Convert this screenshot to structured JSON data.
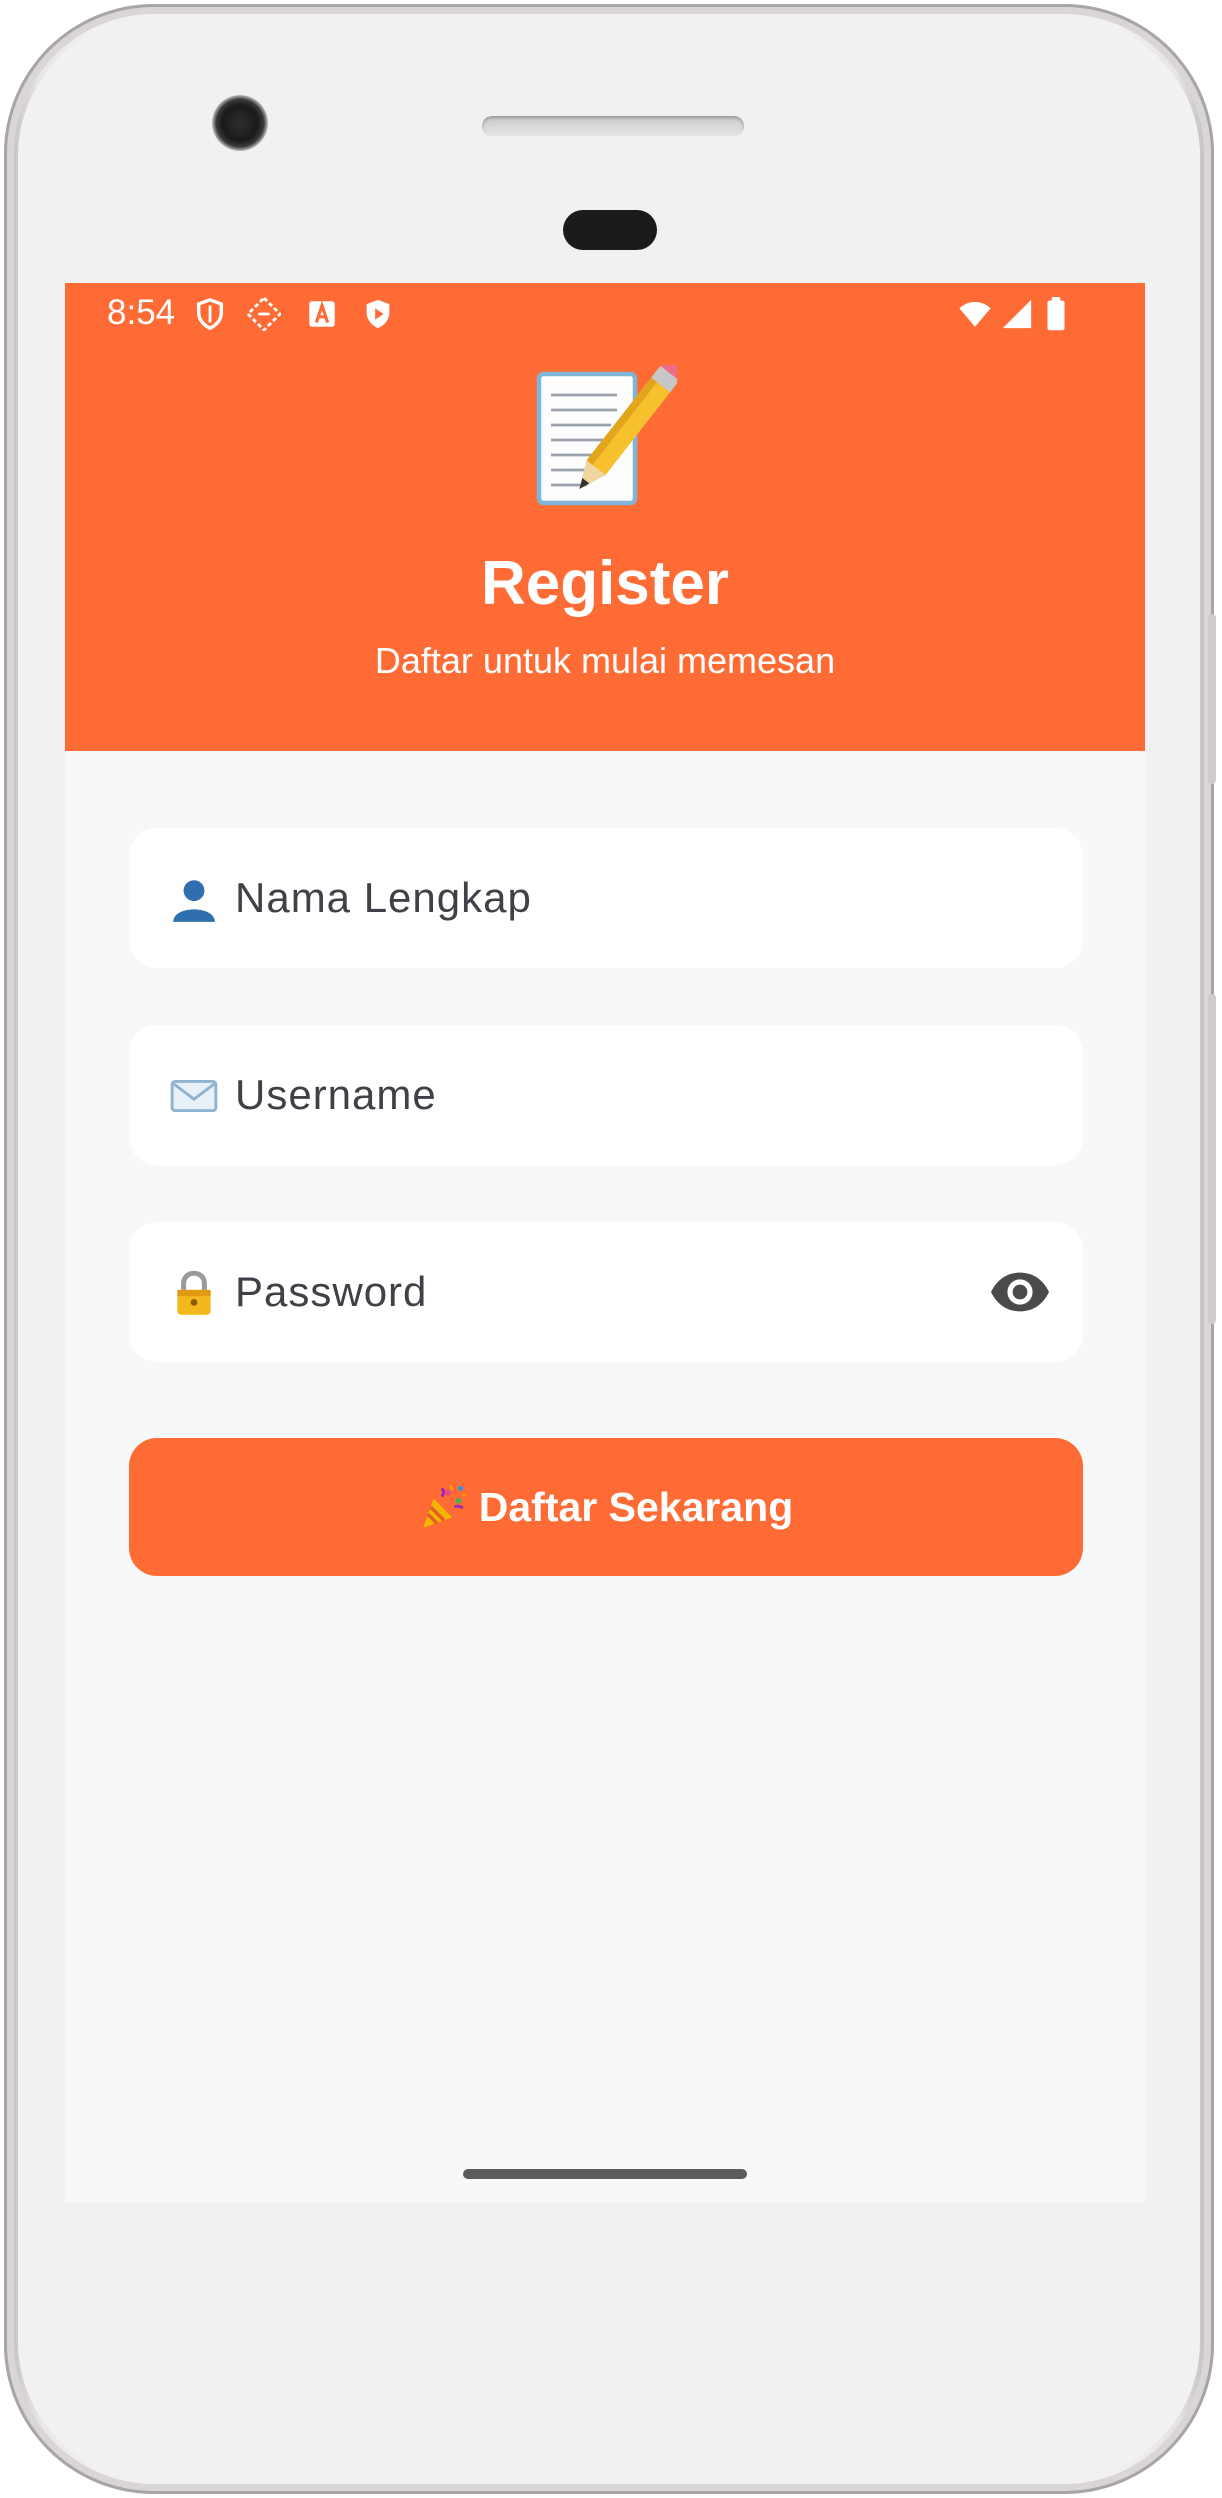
{
  "status_bar": {
    "time": "8:54",
    "left_icons": [
      "shield-outline-icon",
      "dashed-square-icon",
      "font-a-icon",
      "play-shield-icon"
    ],
    "right_icons": [
      "wifi-icon",
      "signal-icon",
      "battery-icon"
    ]
  },
  "header": {
    "emoji_icon": "memo-pencil-icon",
    "title": "Register",
    "subtitle": "Daftar untuk mulai memesan"
  },
  "form": {
    "full_name": {
      "icon": "person-icon",
      "placeholder": "Nama Lengkap"
    },
    "username": {
      "icon": "envelope-icon",
      "placeholder": "Username"
    },
    "password": {
      "icon": "lock-icon",
      "placeholder": "Password",
      "toggle_icon": "eye-icon"
    }
  },
  "submit_button": {
    "icon": "party-popper-icon",
    "label": "Daftar Sekarang"
  },
  "colors": {
    "primary": "#ff6b35",
    "background": "#f7f8fa",
    "field_background": "#ffffff",
    "text": "#3f4148"
  }
}
